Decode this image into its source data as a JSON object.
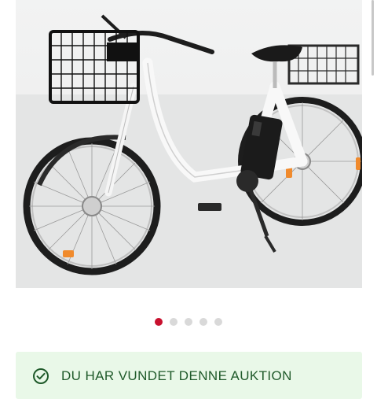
{
  "gallery": {
    "image_alt": "electric bicycle",
    "total_images": 5,
    "active_index": 0
  },
  "banner": {
    "icon": "check-circle-icon",
    "text": "DU HAR VUNDET DENNE AUKTION",
    "color": "#1f5a2a",
    "background": "#e9f8e8"
  },
  "colors": {
    "accent": "#c8102e",
    "inactive_dot": "#d9d9d9"
  }
}
